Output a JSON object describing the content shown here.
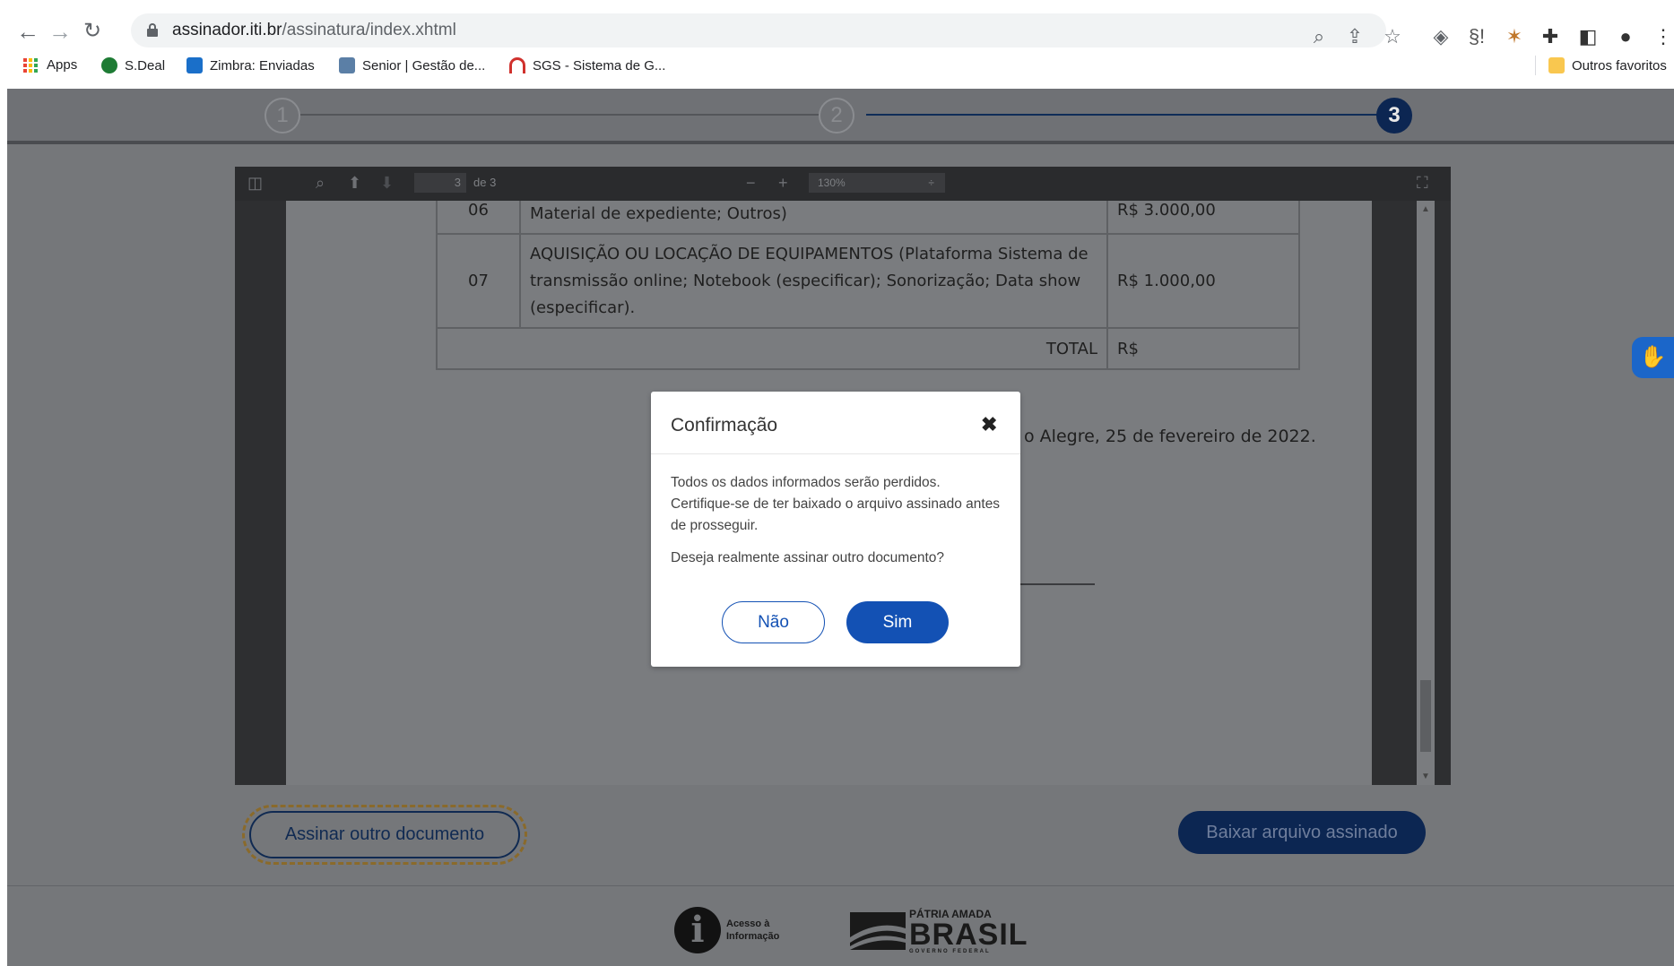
{
  "browser": {
    "url_host": "assinador.iti.br",
    "url_path": "/assinatura/index.xhtml",
    "bookmarks": [
      {
        "label": "Apps"
      },
      {
        "label": "S.Deal"
      },
      {
        "label": "Zimbra: Enviadas"
      },
      {
        "label": "Senior | Gestão de..."
      },
      {
        "label": "SGS - Sistema de G..."
      }
    ],
    "other_bookmarks": "Outros favoritos"
  },
  "stepper": {
    "steps": [
      {
        "label": "1"
      },
      {
        "label": "2"
      },
      {
        "label": "3"
      }
    ],
    "current_step": 3
  },
  "pdf_viewer": {
    "page_current": "3",
    "page_of": "de 3",
    "zoom": "130%",
    "zoom_caret": "÷",
    "table_rows": [
      {
        "num": "06",
        "desc": "internet); Aluguel de espaço de apoio; Telefone fixo ou móvel; Material de expediente; Outros)",
        "value": "R$ 3.000,00"
      },
      {
        "num": "07",
        "desc": "AQUISIÇÃO OU LOCAÇÃO DE EQUIPAMENTOS (Plataforma Sistema de transmissão online; Notebook (especificar); Sonorização; Data show (especificar).",
        "value": "R$ 1.000,00"
      }
    ],
    "total_label": "TOTAL",
    "total_value": "R$",
    "date_text": "o Alegre, 25 de fevereiro de 2022."
  },
  "actions": {
    "sign_another": "Assinar outro documento",
    "download_signed": "Baixar arquivo assinado"
  },
  "footer": {
    "info_line1": "Acesso à",
    "info_line2": "Informação",
    "brasil_line1": "PÁTRIA AMADA",
    "brasil_line2": "BRASIL",
    "brasil_line3": "GOVERNO FEDERAL"
  },
  "modal": {
    "title": "Confirmação",
    "close_glyph": "✖",
    "message1": "Todos os dados informados serão perdidos. Certifique-se de ter baixado o arquivo assinado antes de prosseguir.",
    "message2": "Deseja realmente assinar outro documento?",
    "no_label": "Não",
    "yes_label": "Sim"
  },
  "colors": {
    "primary_blue": "#1351b4",
    "dark_navy": "#0c2652",
    "overlay_gray": "#75777a"
  }
}
